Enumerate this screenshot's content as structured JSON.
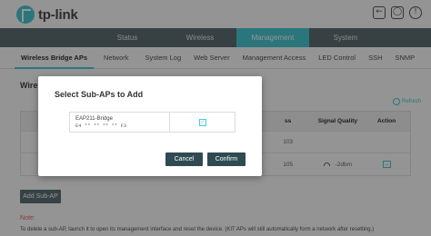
{
  "brand": {
    "name": "tp-link",
    "accent": "#4acbd6"
  },
  "header_icons": [
    "logout-icon",
    "reboot-icon",
    "help-icon"
  ],
  "main_nav": {
    "tabs": [
      {
        "label": "Status",
        "active": false
      },
      {
        "label": "Wireless",
        "active": false
      },
      {
        "label": "Management",
        "active": true
      },
      {
        "label": "System",
        "active": false
      }
    ]
  },
  "sub_nav": {
    "items": [
      {
        "label": "Wireless Bridge APs",
        "active": true
      },
      {
        "label": "Network",
        "active": false
      },
      {
        "label": "System Log",
        "active": false
      },
      {
        "label": "Web Server",
        "active": false
      },
      {
        "label": "Management Access",
        "active": false
      },
      {
        "label": "LED Control",
        "active": false
      },
      {
        "label": "SSH",
        "active": false
      },
      {
        "label": "SNMP",
        "active": false
      }
    ]
  },
  "section": {
    "title": "Wire",
    "refresh_label": "Refresh"
  },
  "table": {
    "headers": [
      "ss",
      "Signal Quality",
      "Action"
    ],
    "rows": [
      {
        "address": "103",
        "signal": "",
        "action": false
      },
      {
        "address": "105",
        "signal": "-2dbm",
        "action": true
      }
    ]
  },
  "add_button_label": "Add Sub-AP",
  "note": {
    "label": "Note:",
    "text": "To delete a sub-AP, launch it to open its management interface and reset the device. (KIT APs will still automatically form a network after resetting.)"
  },
  "modal": {
    "title": "Select Sub-APs to Add",
    "items": [
      {
        "name": "EAP211-Bridge",
        "mac": "E4 ** ** ** ** F3",
        "checked": true
      }
    ],
    "cancel_label": "Cancel",
    "confirm_label": "Confirm"
  }
}
